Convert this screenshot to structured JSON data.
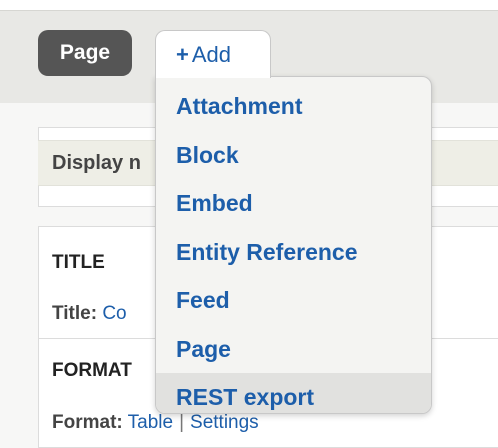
{
  "display_bar": {
    "page_tab_label": "Page",
    "add_button": {
      "icon": "plus-icon",
      "plus_glyph": "+",
      "label": "Add"
    }
  },
  "add_menu": {
    "items": [
      {
        "label": "Attachment",
        "highlighted": false
      },
      {
        "label": "Block",
        "highlighted": false
      },
      {
        "label": "Embed",
        "highlighted": false
      },
      {
        "label": "Entity Reference",
        "highlighted": false
      },
      {
        "label": "Feed",
        "highlighted": false
      },
      {
        "label": "Page",
        "highlighted": false
      },
      {
        "label": "REST export",
        "highlighted": true
      }
    ]
  },
  "main": {
    "display_name_label": "Display n",
    "title_section": {
      "heading": "TITLE",
      "key": "Title:",
      "value": "Co"
    },
    "format_section": {
      "heading": "FORMAT",
      "key": "Format:",
      "value": "Table",
      "separator": "|",
      "settings_link": "Settings"
    }
  },
  "colors": {
    "link": "#1d5eaa",
    "tab_active_bg": "#555555",
    "menu_bg": "#f4f4f2",
    "menu_highlight": "#e1e1df"
  }
}
